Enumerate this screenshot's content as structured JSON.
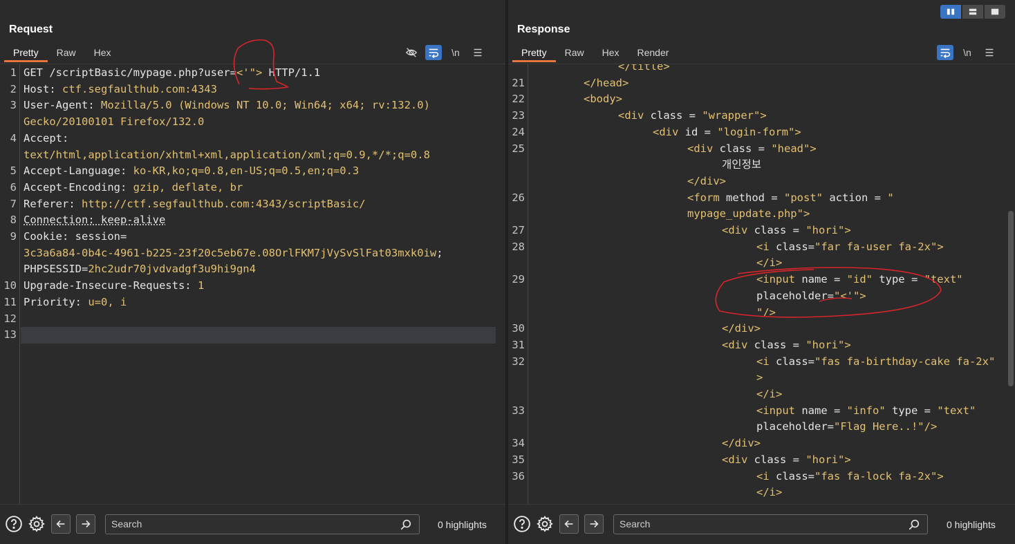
{
  "request": {
    "title": "Request",
    "tabs": [
      "Pretty",
      "Raw",
      "Hex"
    ],
    "active_tab": "Pretty",
    "lines": [
      {
        "n": "1",
        "parts": [
          [
            "plain",
            "GET /scriptBasic/mypage.php?user="
          ],
          [
            "val",
            "<'\">"
          ],
          [
            "plain",
            " HTTP/1.1"
          ]
        ]
      },
      {
        "n": "2",
        "parts": [
          [
            "plain",
            "Host: "
          ],
          [
            "val",
            "ctf.segfaulthub.com:4343"
          ]
        ]
      },
      {
        "n": "3",
        "parts": [
          [
            "plain",
            "User-Agent: "
          ],
          [
            "val",
            "Mozilla/5.0 (Windows NT 10.0; Win64; x64; rv:132.0)"
          ]
        ]
      },
      {
        "n": "",
        "parts": [
          [
            "val",
            "Gecko/20100101 Firefox/132.0"
          ]
        ]
      },
      {
        "n": "4",
        "parts": [
          [
            "plain",
            "Accept:"
          ]
        ]
      },
      {
        "n": "",
        "parts": [
          [
            "val",
            "text/html,application/xhtml+xml,application/xml;q=0.9,*/*;q=0.8"
          ]
        ]
      },
      {
        "n": "5",
        "parts": [
          [
            "plain",
            "Accept-Language: "
          ],
          [
            "val",
            "ko-KR,ko;q=0.8,en-US;q=0.5,en;q=0.3"
          ]
        ]
      },
      {
        "n": "6",
        "parts": [
          [
            "plain",
            "Accept-Encoding: "
          ],
          [
            "val",
            "gzip, deflate, br"
          ]
        ]
      },
      {
        "n": "7",
        "parts": [
          [
            "plain",
            "Referer: "
          ],
          [
            "val",
            "http://ctf.segfaulthub.com:4343/scriptBasic/"
          ]
        ]
      },
      {
        "n": "8",
        "parts": [
          [
            "dot",
            "Connection: keep-alive"
          ]
        ]
      },
      {
        "n": "9",
        "parts": [
          [
            "plain",
            "Cookie: "
          ],
          [
            "plain",
            "session="
          ]
        ]
      },
      {
        "n": "",
        "parts": [
          [
            "val",
            "3c3a6a84-0b4c-4961-b225-23f20c5eb67e.08OrlFKM7jVySvSlFat03mxk0iw"
          ],
          [
            "plain",
            ";"
          ]
        ]
      },
      {
        "n": "",
        "parts": [
          [
            "plain",
            "PHPSESSID="
          ],
          [
            "val",
            "2hc2udr70jvdvadgf3u9hi9gn4"
          ]
        ]
      },
      {
        "n": "10",
        "parts": [
          [
            "plain",
            "Upgrade-Insecure-Requests: "
          ],
          [
            "val",
            "1"
          ]
        ]
      },
      {
        "n": "11",
        "parts": [
          [
            "plain",
            "Priority: "
          ],
          [
            "val",
            "u=0, i"
          ]
        ]
      },
      {
        "n": "12",
        "parts": []
      },
      {
        "n": "13",
        "parts": [],
        "current": true
      }
    ],
    "search_placeholder": "Search",
    "highlights": "0 highlights"
  },
  "response": {
    "title": "Response",
    "tabs": [
      "Pretty",
      "Raw",
      "Hex",
      "Render"
    ],
    "active_tab": "Pretty",
    "lines": [
      {
        "n": "",
        "indent": 10,
        "parts": [
          [
            "tag",
            "</title>"
          ]
        ]
      },
      {
        "n": "21",
        "indent": 6,
        "parts": [
          [
            "tag",
            "</head>"
          ]
        ]
      },
      {
        "n": "22",
        "indent": 6,
        "parts": [
          [
            "tag",
            "<body>"
          ]
        ]
      },
      {
        "n": "23",
        "indent": 10,
        "parts": [
          [
            "tag",
            "<div "
          ],
          [
            "attr",
            "class = "
          ],
          [
            "str",
            "\"wrapper\""
          ],
          [
            "tag",
            ">"
          ]
        ]
      },
      {
        "n": "24",
        "indent": 14,
        "parts": [
          [
            "tag",
            "<div "
          ],
          [
            "attr",
            "id = "
          ],
          [
            "str",
            "\"login-form\""
          ],
          [
            "tag",
            ">"
          ]
        ]
      },
      {
        "n": "25",
        "indent": 18,
        "parts": [
          [
            "tag",
            "<div "
          ],
          [
            "attr",
            "class = "
          ],
          [
            "str",
            "\"head\""
          ],
          [
            "tag",
            ">"
          ]
        ]
      },
      {
        "n": "",
        "indent": 22,
        "parts": [
          [
            "plain",
            "개인정보"
          ]
        ]
      },
      {
        "n": "",
        "indent": 18,
        "parts": [
          [
            "tag",
            "</div>"
          ]
        ]
      },
      {
        "n": "26",
        "indent": 18,
        "parts": [
          [
            "tag",
            "<form "
          ],
          [
            "attr",
            "method = "
          ],
          [
            "str",
            "\"post\""
          ],
          [
            "attr",
            " action = "
          ],
          [
            "str",
            "\""
          ]
        ]
      },
      {
        "n": "",
        "indent": 18,
        "parts": [
          [
            "str",
            "mypage_update.php\""
          ],
          [
            "tag",
            ">"
          ]
        ]
      },
      {
        "n": "27",
        "indent": 22,
        "parts": [
          [
            "tag",
            "<div "
          ],
          [
            "attr",
            "class = "
          ],
          [
            "str",
            "\"hori\""
          ],
          [
            "tag",
            ">"
          ]
        ]
      },
      {
        "n": "28",
        "indent": 26,
        "parts": [
          [
            "tag",
            "<i "
          ],
          [
            "attr",
            "class="
          ],
          [
            "str",
            "\"far fa-user fa-2x\""
          ],
          [
            "tag",
            ">"
          ]
        ]
      },
      {
        "n": "",
        "indent": 26,
        "parts": [
          [
            "tag",
            "</i>"
          ]
        ]
      },
      {
        "n": "29",
        "indent": 26,
        "parts": [
          [
            "tag",
            "<input "
          ],
          [
            "attr",
            "name = "
          ],
          [
            "str",
            "\"id\""
          ],
          [
            "attr",
            " type = "
          ],
          [
            "str",
            "\"text\""
          ]
        ]
      },
      {
        "n": "",
        "indent": 26,
        "parts": [
          [
            "attr",
            "placeholder="
          ],
          [
            "str",
            "\"<'\">"
          ]
        ]
      },
      {
        "n": "",
        "indent": 26,
        "parts": [
          [
            "str",
            "\""
          ],
          [
            "tag",
            "/>"
          ]
        ]
      },
      {
        "n": "30",
        "indent": 22,
        "parts": [
          [
            "tag",
            "</div>"
          ]
        ]
      },
      {
        "n": "31",
        "indent": 22,
        "parts": [
          [
            "tag",
            "<div "
          ],
          [
            "attr",
            "class = "
          ],
          [
            "str",
            "\"hori\""
          ],
          [
            "tag",
            ">"
          ]
        ]
      },
      {
        "n": "32",
        "indent": 26,
        "parts": [
          [
            "tag",
            "<i "
          ],
          [
            "attr",
            "class="
          ],
          [
            "str",
            "\"fas fa-birthday-cake fa-2x\""
          ]
        ]
      },
      {
        "n": "",
        "indent": 26,
        "parts": [
          [
            "tag",
            ">"
          ]
        ]
      },
      {
        "n": "",
        "indent": 26,
        "parts": [
          [
            "tag",
            "</i>"
          ]
        ]
      },
      {
        "n": "33",
        "indent": 26,
        "parts": [
          [
            "tag",
            "<input "
          ],
          [
            "attr",
            "name = "
          ],
          [
            "str",
            "\"info\""
          ],
          [
            "attr",
            " type = "
          ],
          [
            "str",
            "\"text\""
          ]
        ]
      },
      {
        "n": "",
        "indent": 26,
        "parts": [
          [
            "attr",
            "placeholder="
          ],
          [
            "str",
            "\"Flag Here..!\""
          ],
          [
            "tag",
            "/>"
          ]
        ]
      },
      {
        "n": "34",
        "indent": 22,
        "parts": [
          [
            "tag",
            "</div>"
          ]
        ]
      },
      {
        "n": "35",
        "indent": 22,
        "parts": [
          [
            "tag",
            "<div "
          ],
          [
            "attr",
            "class = "
          ],
          [
            "str",
            "\"hori\""
          ],
          [
            "tag",
            ">"
          ]
        ]
      },
      {
        "n": "36",
        "indent": 26,
        "parts": [
          [
            "tag",
            "<i "
          ],
          [
            "attr",
            "class="
          ],
          [
            "str",
            "\"fas fa-lock fa-2x\""
          ],
          [
            "tag",
            ">"
          ]
        ]
      },
      {
        "n": "",
        "indent": 26,
        "parts": [
          [
            "tag",
            "</i>"
          ]
        ]
      }
    ],
    "search_placeholder": "Search",
    "highlights": "0 highlights"
  },
  "icons": {
    "hide": "eye-slash-icon",
    "wrap": "word-wrap-icon",
    "newline": "\\n",
    "menu": "menu-icon",
    "help": "help-icon",
    "settings": "gear-icon",
    "back": "arrow-left-icon",
    "forward": "arrow-right-icon",
    "search": "search-icon"
  },
  "colors": {
    "accent": "#3a74c4",
    "tab_underline": "#e8743c",
    "value": "#e4c171",
    "annotation": "#d9252a"
  }
}
